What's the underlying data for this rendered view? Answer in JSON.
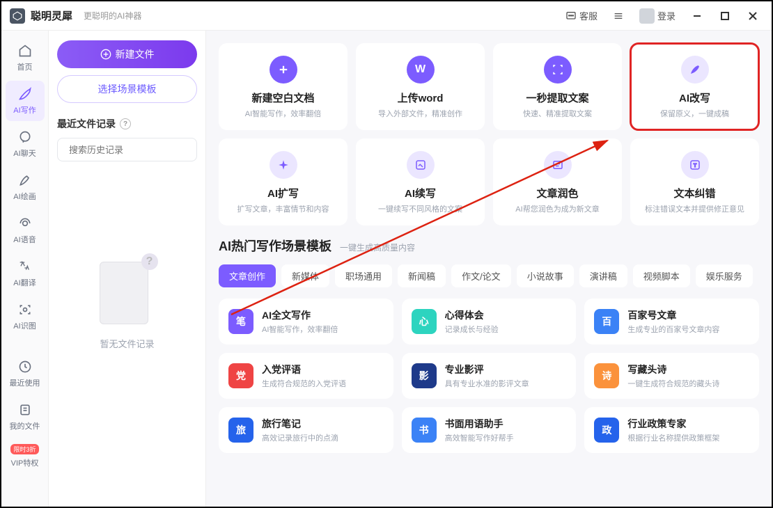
{
  "titlebar": {
    "app_name": "聪明灵犀",
    "tagline": "更聪明的AI神器",
    "support": "客服",
    "login": "登录"
  },
  "sidebar": {
    "items": [
      {
        "label": "首页",
        "icon": "home"
      },
      {
        "label": "AI写作",
        "icon": "pen",
        "active": true
      },
      {
        "label": "AI聊天",
        "icon": "chat"
      },
      {
        "label": "AI绘画",
        "icon": "paint"
      },
      {
        "label": "AI语音",
        "icon": "audio"
      },
      {
        "label": "AI翻译",
        "icon": "translate"
      },
      {
        "label": "AI识图",
        "icon": "vision"
      }
    ],
    "footer_items": [
      {
        "label": "最近使用",
        "icon": "recent"
      },
      {
        "label": "我的文件",
        "icon": "files"
      },
      {
        "label": "VIP特权",
        "badge": "限时3折"
      }
    ]
  },
  "file_panel": {
    "new_file": "新建文件",
    "choose_template": "选择场景模板",
    "recent_title": "最近文件记录",
    "search_placeholder": "搜索历史记录",
    "empty_text": "暂无文件记录"
  },
  "tools_row1": [
    {
      "title": "新建空白文档",
      "desc": "AI智能写作，效率翻倍",
      "icon": "plus"
    },
    {
      "title": "上传word",
      "desc": "导入外部文件，精准创作",
      "icon": "word"
    },
    {
      "title": "一秒提取文案",
      "desc": "快速、精准提取文案",
      "icon": "extract"
    },
    {
      "title": "AI改写",
      "desc": "保留原义，一键成稿",
      "icon": "rewrite",
      "highlight": true
    }
  ],
  "tools_row2": [
    {
      "title": "AI扩写",
      "desc": "扩写文章，丰富情节和内容",
      "icon": "expand"
    },
    {
      "title": "AI续写",
      "desc": "一键续写不同风格的文案",
      "icon": "continue"
    },
    {
      "title": "文章润色",
      "desc": "AI帮您润色为成为新文章",
      "icon": "polish"
    },
    {
      "title": "文本纠错",
      "desc": "标注错误文本并提供修正意见",
      "icon": "correct"
    }
  ],
  "templates": {
    "section_title": "AI热门写作场景模板",
    "section_sub": "一键生成高质量内容",
    "tabs": [
      "文章创作",
      "新媒体",
      "职场通用",
      "新闻稿",
      "作文/论文",
      "小说故事",
      "演讲稿",
      "视频脚本",
      "娱乐服务"
    ],
    "active_tab": 0,
    "items": [
      {
        "title": "AI全文写作",
        "desc": "AI智能写作，效率翻倍",
        "color": "purple",
        "icon": "笔"
      },
      {
        "title": "心得体会",
        "desc": "记录成长与经验",
        "color": "teal",
        "icon": "心"
      },
      {
        "title": "百家号文章",
        "desc": "生成专业的百家号文章内容",
        "color": "blue",
        "icon": "百"
      },
      {
        "title": "入党评语",
        "desc": "生成符合规范的入党评语",
        "color": "red",
        "icon": "党"
      },
      {
        "title": "专业影评",
        "desc": "具有专业水准的影评文章",
        "color": "navy",
        "icon": "影"
      },
      {
        "title": "写藏头诗",
        "desc": "一键生成符合规范的藏头诗",
        "color": "orange",
        "icon": "诗"
      },
      {
        "title": "旅行笔记",
        "desc": "高效记录旅行中的点滴",
        "color": "blue2",
        "icon": "旅"
      },
      {
        "title": "书面用语助手",
        "desc": "高效智能写作好帮手",
        "color": "blue",
        "icon": "书"
      },
      {
        "title": "行业政策专家",
        "desc": "根据行业名称提供政策框架",
        "color": "blue2",
        "icon": "政"
      }
    ]
  }
}
